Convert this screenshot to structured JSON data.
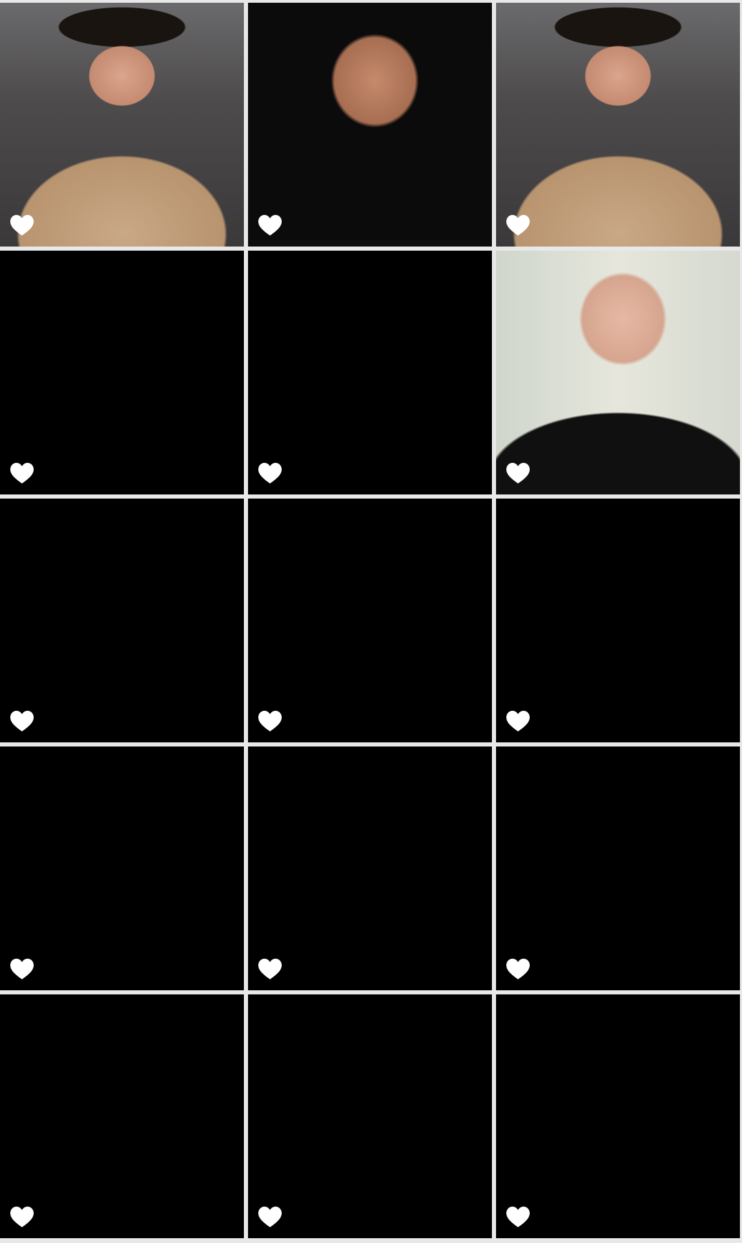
{
  "grid": {
    "tiles": [
      {
        "kind": "room",
        "liked": true
      },
      {
        "kind": "dark-face",
        "liked": true
      },
      {
        "kind": "room",
        "liked": true
      },
      {
        "kind": "black",
        "liked": true
      },
      {
        "kind": "black",
        "liked": true
      },
      {
        "kind": "light-face",
        "liked": true
      },
      {
        "kind": "black",
        "liked": true
      },
      {
        "kind": "black",
        "liked": true
      },
      {
        "kind": "black",
        "liked": true
      },
      {
        "kind": "black",
        "liked": true
      },
      {
        "kind": "black",
        "liked": true
      },
      {
        "kind": "black",
        "liked": true
      },
      {
        "kind": "black",
        "liked": true
      },
      {
        "kind": "black",
        "liked": true
      },
      {
        "kind": "black",
        "liked": true
      }
    ]
  },
  "icons": {
    "heart": "heart-icon"
  },
  "colors": {
    "heart": "#ffffff",
    "divider": "#e8e8e8",
    "tile_background": "#000000"
  }
}
